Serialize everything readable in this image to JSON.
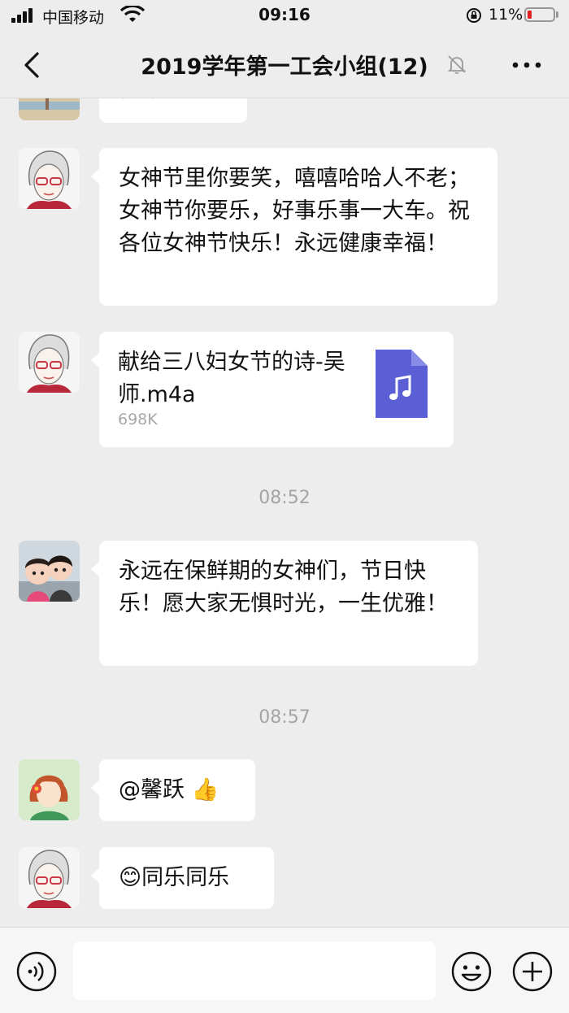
{
  "status_bar": {
    "carrier": "中国移动",
    "time": "09:16",
    "battery_percent": "11%"
  },
  "header": {
    "title": "2019学年第一工会小组(12)"
  },
  "messages": [
    {
      "type": "text",
      "text": "优雅时光",
      "avatar": "beach-photo"
    },
    {
      "type": "text",
      "text": "女神节里你要笑，嘻嘻哈哈人不老；女神节你要乐，好事乐事一大车。祝各位女神节快乐！永远健康幸福！",
      "avatar": "glasses-woman-sketch"
    },
    {
      "type": "file",
      "file_name": "献给三八妇女节的诗-吴师.m4a",
      "file_size": "698K",
      "avatar": "glasses-woman-sketch"
    },
    {
      "type": "time",
      "text": "08:52"
    },
    {
      "type": "text",
      "text": "永远在保鲜期的女神们，节日快乐！愿大家无惧时光，一生优雅！",
      "avatar": "couple-cartoon"
    },
    {
      "type": "time",
      "text": "08:57"
    },
    {
      "type": "text",
      "text": "@馨跃 👍",
      "avatar": "cartoon-girl-bob"
    },
    {
      "type": "text",
      "text": "😊同乐同乐",
      "avatar": "glasses-woman-sketch"
    }
  ],
  "input": {
    "placeholder": ""
  },
  "colors": {
    "background": "#ededed",
    "bubble": "#ffffff",
    "file_icon": "#5b5fd6",
    "battery_low": "#e02020"
  }
}
